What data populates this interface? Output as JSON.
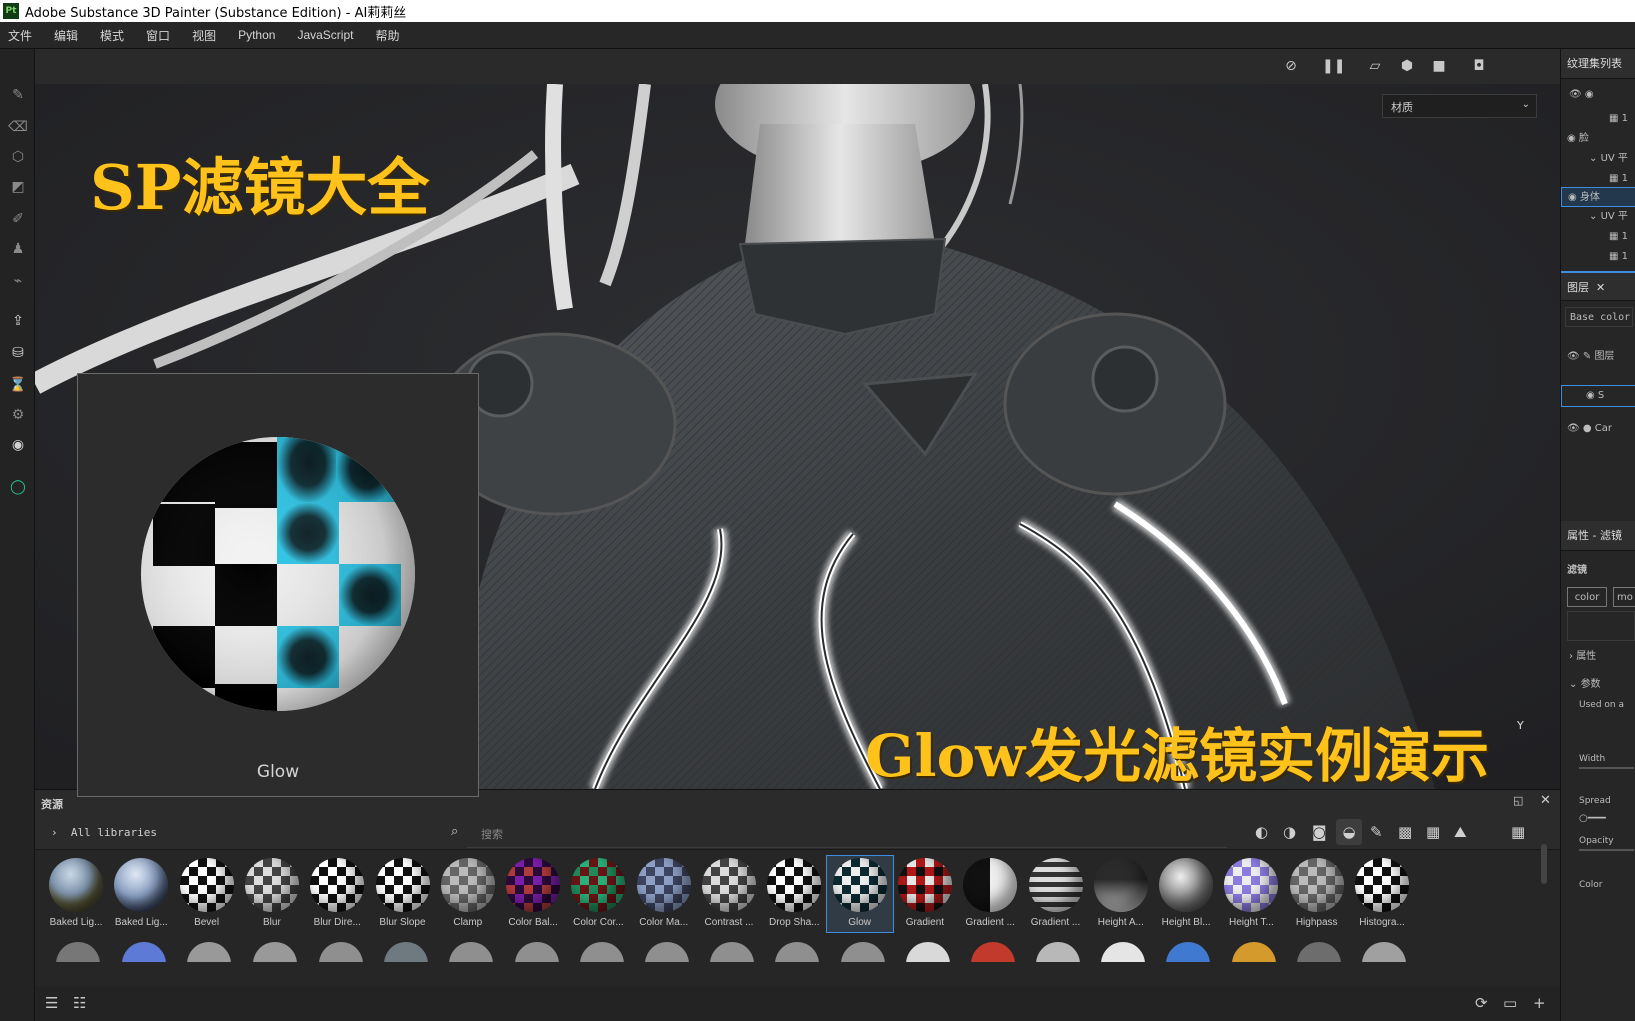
{
  "window": {
    "app_icon": "Pt",
    "title": "Adobe Substance 3D Painter (Substance Edition) - AI莉莉丝"
  },
  "menu": [
    "文件",
    "编辑",
    "模式",
    "窗口",
    "视图",
    "Python",
    "JavaScript",
    "帮助"
  ],
  "viewport": {
    "material_select": "材质",
    "overlay_title": "SP滤镜大全",
    "overlay_subtitle": "Glow发光滤镜实例演示",
    "axis_label": "Y"
  },
  "preview": {
    "label": "Glow"
  },
  "right_panel": {
    "texture_sets_title": "纹理集列表",
    "texture_sets": [
      "脸",
      "UV 平",
      "身体",
      "UV 平"
    ],
    "layers_title": "图层",
    "channel": "Base color",
    "layer_items": [
      "图层",
      "Car"
    ],
    "properties_title": "属性 - 滤镜",
    "filter_label": "滤镜",
    "filter_chip": "color",
    "filter_chip2": "mo",
    "section_attr": "属性",
    "section_params": "参数",
    "used_on": "Used on a",
    "param_width": "Width",
    "param_spread": "Spread",
    "param_opacity": "Opacity",
    "param_color": "Color"
  },
  "assets": {
    "title": "资源",
    "library": "All libraries",
    "search_placeholder": "搜索",
    "items": [
      {
        "label": "Baked Lig...",
        "style": "env"
      },
      {
        "label": "Baked Lig...",
        "style": "env2"
      },
      {
        "label": "Bevel",
        "style": "checker"
      },
      {
        "label": "Blur",
        "style": "checker-soft"
      },
      {
        "label": "Blur Dire...",
        "style": "checker"
      },
      {
        "label": "Blur Slope",
        "style": "checker"
      },
      {
        "label": "Clamp",
        "style": "gray-checker"
      },
      {
        "label": "Color Bal...",
        "style": "purple"
      },
      {
        "label": "Color Cor...",
        "style": "green"
      },
      {
        "label": "Color Ma...",
        "style": "bluegray"
      },
      {
        "label": "Contrast ...",
        "style": "checker-soft"
      },
      {
        "label": "Drop Sha...",
        "style": "checker"
      },
      {
        "label": "Glow",
        "style": "glow"
      },
      {
        "label": "Gradient",
        "style": "red"
      },
      {
        "label": "Gradient ...",
        "style": "half"
      },
      {
        "label": "Gradient ...",
        "style": "stripes"
      },
      {
        "label": "Height A...",
        "style": "spikes"
      },
      {
        "label": "Height Bl...",
        "style": "metal"
      },
      {
        "label": "Height T...",
        "style": "violet"
      },
      {
        "label": "Highpass",
        "style": "gray-checker"
      },
      {
        "label": "Histogra...",
        "style": "checker"
      }
    ],
    "selected_index": 12
  },
  "colors": {
    "accent": "#ffc21a",
    "selection": "#3d8ee0",
    "glow": "#2fc5e6"
  }
}
